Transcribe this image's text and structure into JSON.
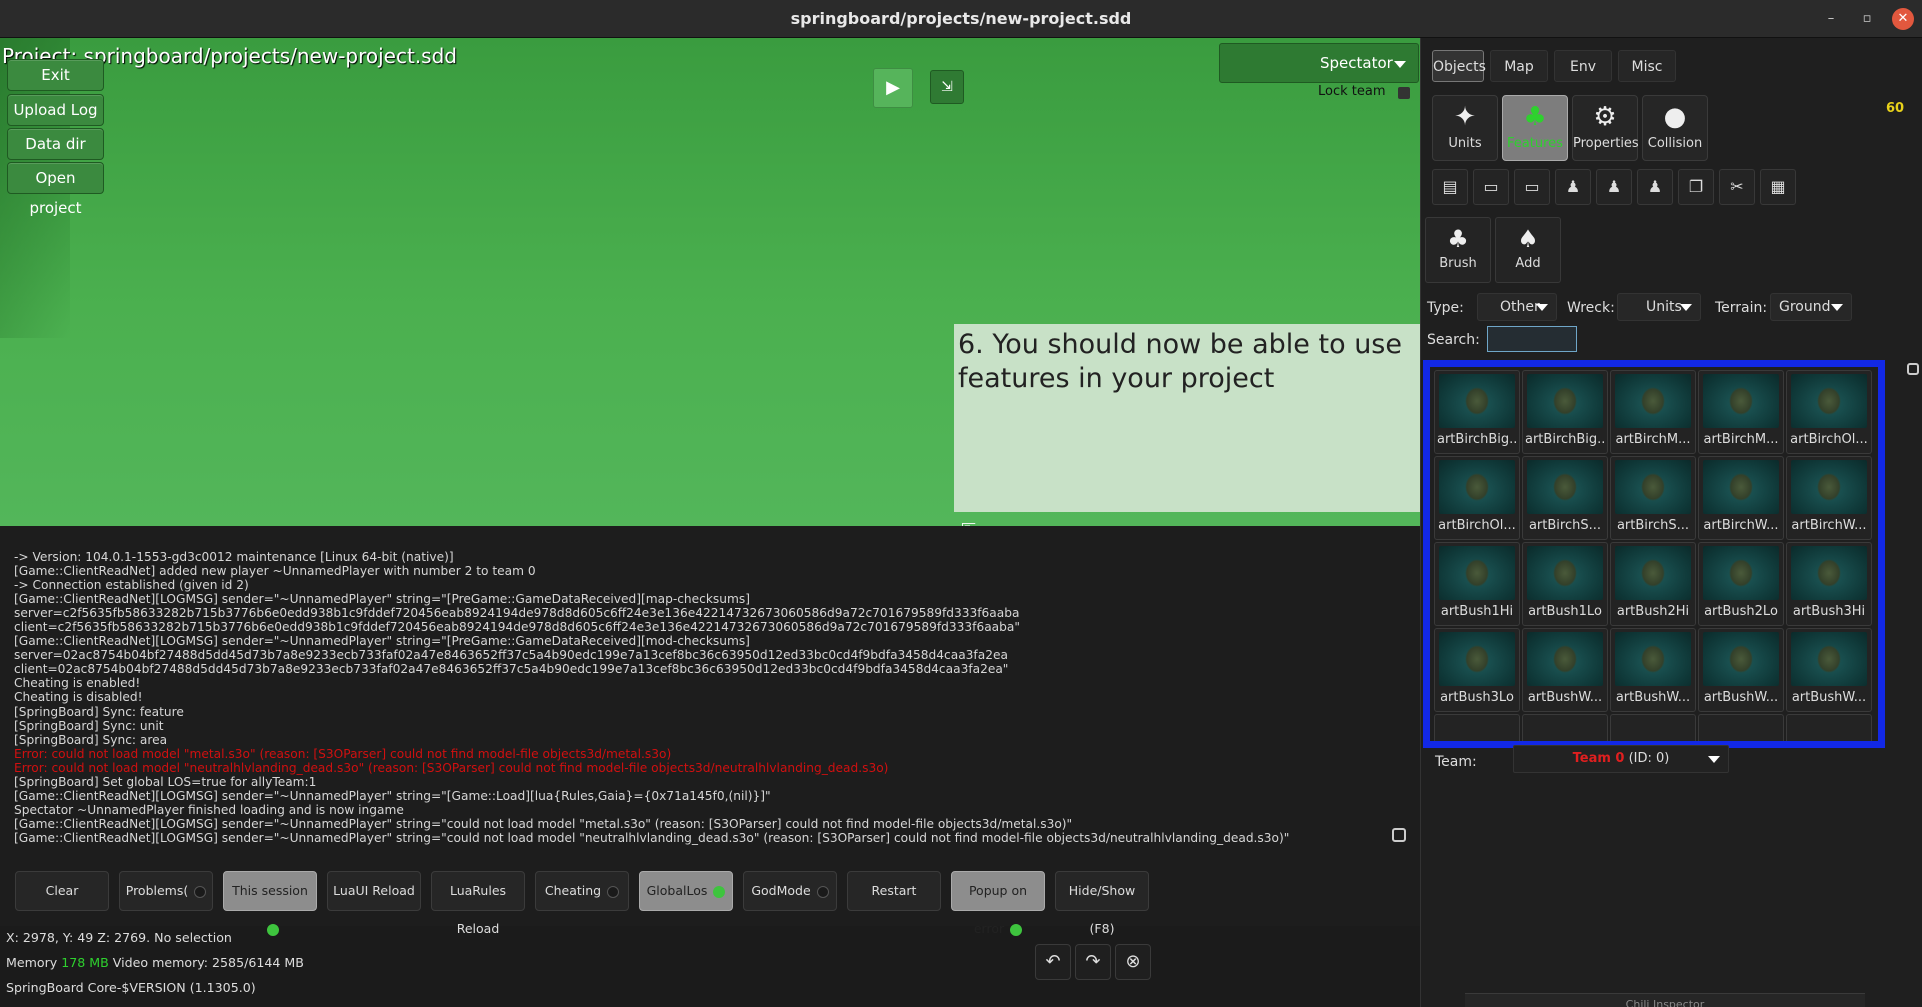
{
  "window": {
    "title": "springboard/projects/new-project.sdd"
  },
  "viewport": {
    "project_title": "Project: springboard/projects/new-project.sdd",
    "buttons": {
      "exit": "Exit",
      "upload_log": "Upload Log",
      "data_dir": "Data dir",
      "open_project": "Open project"
    },
    "play_icon": "play-icon",
    "spectator": "Spectator",
    "lock_team": "Lock team",
    "callout": "6. You should now be able to use features in your project"
  },
  "console": {
    "lines": [
      {
        "t": " -> Version: 104.0.1-1553-gd3c0012 maintenance [Linux 64-bit (native)]",
        "e": false
      },
      {
        "t": "[Game::ClientReadNet] added new player ~UnnamedPlayer with number 2 to team 0",
        "e": false
      },
      {
        "t": " -> Connection established (given id 2)",
        "e": false
      },
      {
        "t": "[Game::ClientReadNet][LOGMSG] sender=\"~UnnamedPlayer\" string=\"[PreGame::GameDataReceived][map-checksums]",
        "e": false
      },
      {
        "t": "  server=c2f5635fb58633282b715b3776b6e0edd938b1c9fddef720456eab8924194de978d8d605c6ff24e3e136e42214732673060586d9a72c701679589fd333f6aaba",
        "e": false
      },
      {
        "t": "  client=c2f5635fb58633282b715b3776b6e0edd938b1c9fddef720456eab8924194de978d8d605c6ff24e3e136e42214732673060586d9a72c701679589fd333f6aaba\"",
        "e": false
      },
      {
        "t": "[Game::ClientReadNet][LOGMSG] sender=\"~UnnamedPlayer\" string=\"[PreGame::GameDataReceived][mod-checksums]",
        "e": false
      },
      {
        "t": "  server=02ac8754b04bf27488d5dd45d73b7a8e9233ecb733faf02a47e8463652ff37c5a4b90edc199e7a13cef8bc36c63950d12ed33bc0cd4f9bdfa3458d4caa3fa2ea",
        "e": false
      },
      {
        "t": "  client=02ac8754b04bf27488d5dd45d73b7a8e9233ecb733faf02a47e8463652ff37c5a4b90edc199e7a13cef8bc36c63950d12ed33bc0cd4f9bdfa3458d4caa3fa2ea\"",
        "e": false
      },
      {
        "t": "Cheating is enabled!",
        "e": false
      },
      {
        "t": "Cheating is disabled!",
        "e": false
      },
      {
        "t": "[SpringBoard] Sync: feature",
        "e": false
      },
      {
        "t": "[SpringBoard] Sync: unit",
        "e": false
      },
      {
        "t": "[SpringBoard] Sync: area",
        "e": false
      },
      {
        "t": "Error: could not load model \"metal.s3o\" (reason: [S3OParser] could not find model-file objects3d/metal.s3o)",
        "e": true
      },
      {
        "t": "Error: could not load model \"neutralhlvlanding_dead.s3o\" (reason: [S3OParser] could not find model-file objects3d/neutralhlvlanding_dead.s3o)",
        "e": true
      },
      {
        "t": "[SpringBoard] Set global LOS=true for allyTeam:1",
        "e": false
      },
      {
        "t": "[Game::ClientReadNet][LOGMSG] sender=\"~UnnamedPlayer\" string=\"[Game::Load][lua{Rules,Gaia}={0x71a145f0,(nil)}]\"",
        "e": false
      },
      {
        "t": "Spectator ~UnnamedPlayer finished loading and is now ingame",
        "e": false
      },
      {
        "t": "[Game::ClientReadNet][LOGMSG] sender=\"~UnnamedPlayer\" string=\"could not load model \"metal.s3o\" (reason: [S3OParser] could not find model-file objects3d/metal.s3o)\"",
        "e": false
      },
      {
        "t": "[Game::ClientReadNet][LOGMSG] sender=\"~UnnamedPlayer\" string=\"could not load model \"neutralhlvlanding_dead.s3o\" (reason: [S3OParser] could not find model-file objects3d/neutralhlvlanding_dead.s3o)\"",
        "e": false
      }
    ],
    "buttons": [
      {
        "label": "Clear",
        "w": 94,
        "dot": "none",
        "on": false
      },
      {
        "label": "Problems(",
        "w": 94,
        "dot": "off",
        "on": false
      },
      {
        "label": "This session",
        "w": 94,
        "dot": "green",
        "on": true
      },
      {
        "label": "LuaUI Reload",
        "w": 94,
        "dot": "none",
        "on": false
      },
      {
        "label": "LuaRules Reload",
        "w": 94,
        "dot": "none",
        "on": false
      },
      {
        "label": "Cheating",
        "w": 94,
        "dot": "off",
        "on": false
      },
      {
        "label": "GlobalLos",
        "w": 94,
        "dot": "green",
        "on": true
      },
      {
        "label": "GodMode",
        "w": 94,
        "dot": "off",
        "on": false
      },
      {
        "label": "Restart",
        "w": 94,
        "dot": "none",
        "on": false
      },
      {
        "label": "Popup on error",
        "w": 94,
        "dot": "green",
        "on": true
      },
      {
        "label": "Hide/Show (F8)",
        "w": 94,
        "dot": "none",
        "on": false
      }
    ]
  },
  "status": {
    "coords": "X: 2978, Y: 49 Z: 2769. No selection",
    "memory_label": "Memory",
    "memory_value": "178 MB",
    "video_memory": "Video memory: 2585/6144 MB",
    "version": "SpringBoard Core-$VERSION (1.1305.0)"
  },
  "panel": {
    "tabs": [
      "Objects",
      "Map",
      "Env",
      "Misc"
    ],
    "fps": "60",
    "tools": [
      {
        "label": "Units",
        "icon": "unit-icon"
      },
      {
        "label": "Features",
        "icon": "tree-icon"
      },
      {
        "label": "Properties",
        "icon": "properties-icon"
      },
      {
        "label": "Collision",
        "icon": "collision-icon"
      }
    ],
    "brush_label": "Brush",
    "add_label": "Add",
    "filters": {
      "type_label": "Type:",
      "type_value": "Other",
      "wreck_label": "Wreck:",
      "wreck_value": "Units",
      "terrain_label": "Terrain:",
      "terrain_value": "Ground",
      "search_label": "Search:",
      "search_value": ""
    },
    "features": [
      "artBirchBig...",
      "artBirchBig...",
      "artBirchM...",
      "artBirchM...",
      "artBirchOl...",
      "artBirchOl...",
      "artBirchS...",
      "artBirchS...",
      "artBirchW...",
      "artBirchW...",
      "artBush1Hi",
      "artBush1Lo",
      "artBush2Hi",
      "artBush2Lo",
      "artBush3Hi",
      "artBush3Lo",
      "artBushW...",
      "artBushW...",
      "artBushW...",
      "artBushW..."
    ],
    "team_label": "Team:",
    "team_name": "Team 0",
    "team_id": "(ID: 0)",
    "inspector": "Chili Inspector",
    "highlight_color": "#1228e6"
  }
}
